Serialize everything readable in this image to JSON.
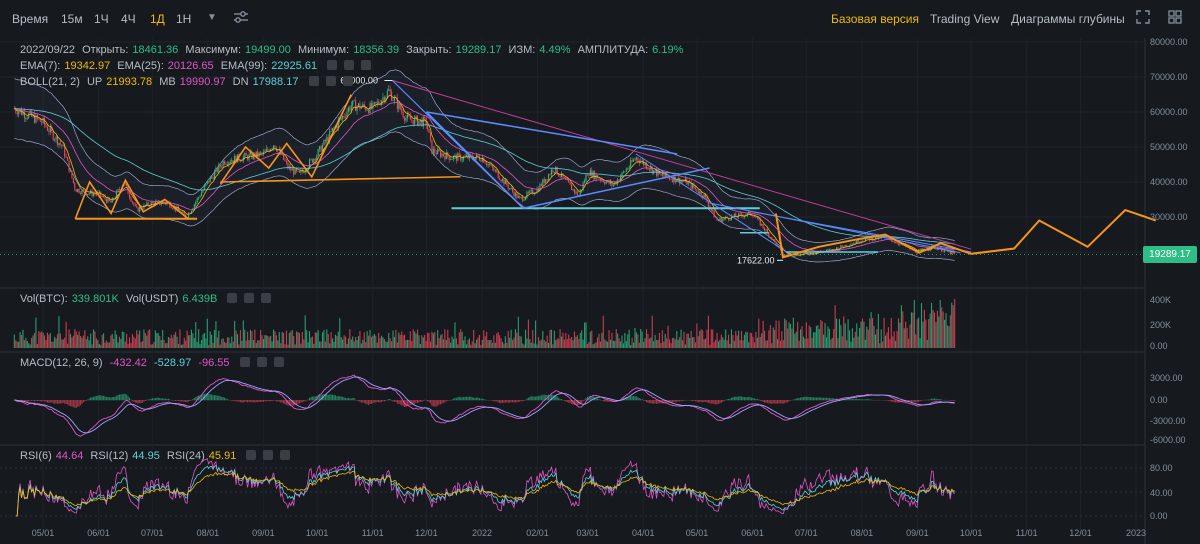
{
  "toolbar": {
    "time_label": "Время",
    "intervals": [
      "15м",
      "1Ч",
      "4Ч",
      "1Д",
      "1Н"
    ],
    "active_interval": "1Д",
    "views": [
      "Базовая версия",
      "Trading View",
      "Диаграммы глубины"
    ],
    "active_view": "Базовая версия"
  },
  "ohlc": {
    "date": "2022/09/22",
    "open_label": "Открыть:",
    "open": "18461.36",
    "high_label": "Максимум:",
    "high": "19499.00",
    "low_label": "Минимум:",
    "low": "18356.39",
    "close_label": "Закрыть:",
    "close": "19289.17",
    "change_label": "ИЗМ:",
    "change": "4.49%",
    "amp_label": "АМПЛИТУДА:",
    "amp": "6.19%"
  },
  "ema": {
    "e7_label": "EMA(7):",
    "e7": "19342.97",
    "e25_label": "EMA(25):",
    "e25": "20126.65",
    "e99_label": "EMA(99):",
    "e99": "22925.61"
  },
  "boll": {
    "label": "BOLL(21, 2)",
    "up_label": "UP",
    "up": "21993.78",
    "mb_label": "MB",
    "mb": "19990.97",
    "dn_label": "DN",
    "dn": "17988.17"
  },
  "vol": {
    "btc_label": "Vol(BTC):",
    "btc": "339.801K",
    "usdt_label": "Vol(USDT)",
    "usdt": "6.439B"
  },
  "macd": {
    "label": "MACD(12, 26, 9)",
    "v1": "-432.42",
    "v2": "-528.97",
    "v3": "-96.55"
  },
  "rsi": {
    "r6_label": "RSI(6)",
    "r6": "44.64",
    "r12_label": "RSI(12)",
    "r12": "44.95",
    "r24_label": "RSI(24)",
    "r24": "45.91"
  },
  "price_axis": [
    "80000.00",
    "70000.00",
    "60000.00",
    "50000.00",
    "40000.00",
    "30000.00",
    "20000.00"
  ],
  "vol_axis": [
    "400K",
    "200K",
    "0.00"
  ],
  "macd_axis": [
    "3000.00",
    "0.00",
    "-3000.00",
    "-6000.00"
  ],
  "rsi_axis": [
    "80.00",
    "40.00",
    "0.00"
  ],
  "time_axis": [
    "05/01",
    "06/01",
    "07/01",
    "08/01",
    "09/01",
    "10/01",
    "11/01",
    "12/01",
    "2022",
    "02/01",
    "03/01",
    "04/01",
    "05/01",
    "06/01",
    "07/01",
    "08/01",
    "09/01",
    "10/01",
    "11/01",
    "12/01",
    "2023"
  ],
  "annotations": {
    "high": "69000.00",
    "low": "17622.00"
  },
  "current_price": "19289.17",
  "colors": {
    "up": "#2ebd85",
    "down": "#f6465d",
    "accent": "#f0b90b",
    "ema7": "#f0b90b",
    "ema25": "#e054c8",
    "ema99": "#5ecfd8"
  },
  "chart_data": {
    "type": "line",
    "x": [
      "2021-04-15",
      "2021-05-01",
      "2021-05-12",
      "2021-05-19",
      "2021-05-25",
      "2021-06-01",
      "2021-06-08",
      "2021-06-15",
      "2021-06-22",
      "2021-07-01",
      "2021-07-10",
      "2021-07-20",
      "2021-08-01",
      "2021-08-10",
      "2021-08-20",
      "2021-09-01",
      "2021-09-07",
      "2021-09-15",
      "2021-09-21",
      "2021-10-01",
      "2021-10-10",
      "2021-10-20",
      "2021-11-01",
      "2021-11-10",
      "2021-11-20",
      "2021-12-01",
      "2021-12-04",
      "2021-12-15",
      "2022-01-01",
      "2022-01-10",
      "2022-01-22",
      "2022-02-01",
      "2022-02-10",
      "2022-02-24",
      "2022-03-01",
      "2022-03-15",
      "2022-03-28",
      "2022-04-10",
      "2022-04-25",
      "2022-05-05",
      "2022-05-12",
      "2022-05-20",
      "2022-06-01",
      "2022-06-13",
      "2022-06-18",
      "2022-07-01",
      "2022-07-15",
      "2022-08-01",
      "2022-08-14",
      "2022-09-01",
      "2022-09-10",
      "2022-09-22"
    ],
    "series": [
      {
        "values": [
          61000,
          57000,
          50000,
          38000,
          37000,
          36500,
          34000,
          40000,
          32000,
          34000,
          34000,
          30000,
          40000,
          46000,
          47000,
          48000,
          51000,
          44000,
          42000,
          48000,
          55000,
          62000,
          61000,
          66000,
          58000,
          57000,
          49000,
          47000,
          47000,
          42000,
          35000,
          38000,
          44000,
          36000,
          43000,
          39000,
          47000,
          42000,
          40000,
          36000,
          29000,
          30000,
          31000,
          23000,
          19000,
          19500,
          20500,
          23500,
          24300,
          20000,
          21500,
          19289
        ]
      }
    ],
    "ylim": [
      15000,
      80000
    ]
  }
}
